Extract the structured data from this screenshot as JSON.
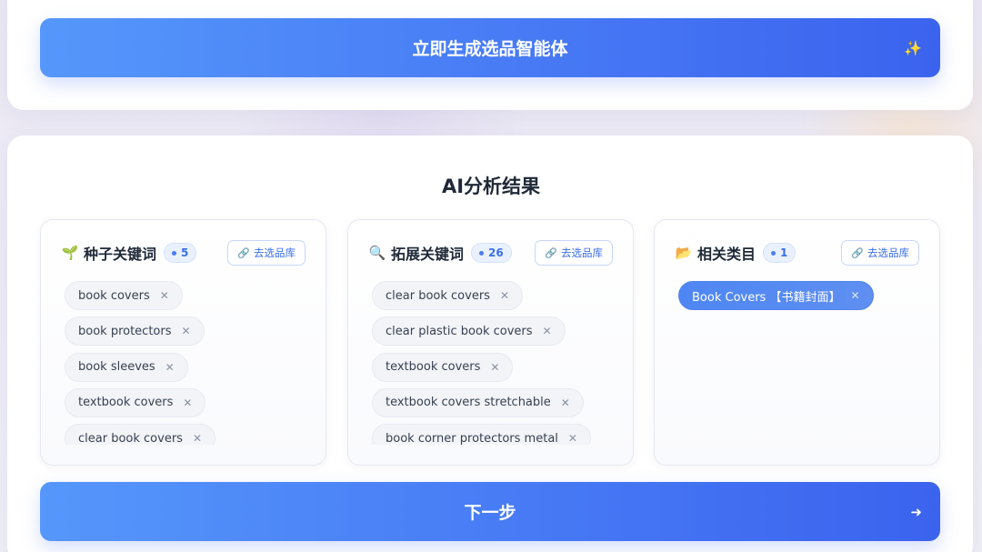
{
  "top": {
    "generate_label": "立即生成选品智能体",
    "generate_icon": "sparkle-icon"
  },
  "results": {
    "title": "AI分析结果"
  },
  "cards": {
    "seed": {
      "icon": "seedling-icon",
      "title": "种子关键词",
      "count": "5",
      "lib_label": "去选品库",
      "tags": [
        "book covers",
        "book protectors",
        "book sleeves",
        "textbook covers",
        "clear book covers"
      ]
    },
    "expand": {
      "icon": "magnifier-icon",
      "title": "拓展关键词",
      "count": "26",
      "lib_label": "去选品库",
      "tags": [
        "clear book covers",
        "clear plastic book covers",
        "textbook covers",
        "textbook covers stretchable",
        "book corner protectors metal"
      ]
    },
    "category": {
      "icon": "folder-icon",
      "title": "相关类目",
      "count": "1",
      "lib_label": "去选品库",
      "tags": [
        "Book Covers 【书籍封面】"
      ]
    }
  },
  "next": {
    "label": "下一步",
    "icon": "arrow-right-icon"
  },
  "colors": {
    "primary": "#4677f4",
    "primary_light": "#5597fb",
    "badge_bg": "#eaf1fe"
  }
}
